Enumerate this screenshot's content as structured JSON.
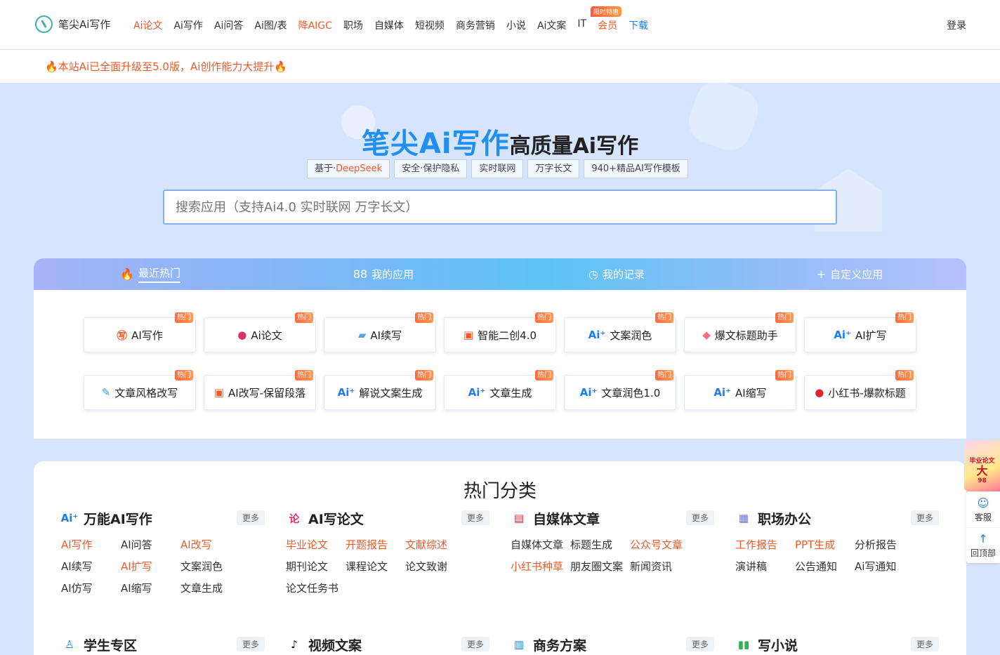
{
  "header": {
    "logo": "笔尖Ai写作",
    "nav": [
      {
        "label": "Ai论文",
        "style": "red"
      },
      {
        "label": "Ai写作",
        "style": ""
      },
      {
        "label": "Ai问答",
        "style": ""
      },
      {
        "label": "Ai图/表",
        "style": ""
      },
      {
        "label": "降AIGC",
        "style": "red"
      },
      {
        "label": "职场",
        "style": ""
      },
      {
        "label": "自媒体",
        "style": ""
      },
      {
        "label": "短视频",
        "style": ""
      },
      {
        "label": "商务营销",
        "style": ""
      },
      {
        "label": "小说",
        "style": ""
      },
      {
        "label": "Ai文案",
        "style": ""
      },
      {
        "label": "IT",
        "style": ""
      },
      {
        "label": "会员",
        "style": "red"
      },
      {
        "label": "下载",
        "style": "blue"
      }
    ],
    "limited_badge": "限时特惠",
    "login": "登录"
  },
  "notice": "🔥本站Ai已全面升级至5.0版，Ai创作能力大提升🔥",
  "hero": {
    "brand": "笔尖Ai写作",
    "tagline": "高质量Ai写作",
    "tag_prefix": "基于·",
    "tag_highlight": "DeepSeek",
    "tags": [
      "安全·保护隐私",
      "实时联网",
      "万字长文",
      "940+精品AI写作模板"
    ],
    "search_placeholder": "搜索应用（支持Ai4.0 实时联网 万字长文）"
  },
  "tabs": [
    {
      "icon": "🔥",
      "icon_name": "flame-icon",
      "label": "最近热门",
      "active": true
    },
    {
      "icon": "88",
      "icon_name": "grid-icon",
      "label": "我的应用",
      "active": false
    },
    {
      "icon": "◷",
      "icon_name": "clock-icon",
      "label": "我的记录",
      "active": false
    },
    {
      "icon": "+",
      "icon_name": "plus-icon",
      "label": "自定义应用",
      "active": false
    }
  ],
  "hot_label": "热门",
  "apps": [
    {
      "label": "AI写作",
      "icon": "㊢",
      "color": "#f05a28"
    },
    {
      "label": "Ai论文",
      "icon": "●",
      "color": "#d6336c"
    },
    {
      "label": "AI续写",
      "icon": "▰",
      "color": "#5aa0e6"
    },
    {
      "label": "智能二创4.0",
      "icon": "▣",
      "color": "#f05a28"
    },
    {
      "label": "文案润色",
      "icon": "Ai⁺",
      "color": "#1a7df0"
    },
    {
      "label": "爆文标题助手",
      "icon": "◆",
      "color": "#ff6b7a"
    },
    {
      "label": "AI扩写",
      "icon": "Ai⁺",
      "color": "#1a7df0"
    },
    {
      "label": "文章风格改写",
      "icon": "✎",
      "color": "#3aa0e6"
    },
    {
      "label": "AI改写-保留段落",
      "icon": "▣",
      "color": "#f05a28"
    },
    {
      "label": "解说文案生成",
      "icon": "Ai⁺",
      "color": "#1a7df0"
    },
    {
      "label": "文章生成",
      "icon": "Ai⁺",
      "color": "#1a7df0"
    },
    {
      "label": "文章润色1.0",
      "icon": "Ai⁺",
      "color": "#1a7df0"
    },
    {
      "label": "AI缩写",
      "icon": "Ai⁺",
      "color": "#1a7df0"
    },
    {
      "label": "小红书-爆款标题",
      "icon": "●",
      "color": "#e0242e"
    }
  ],
  "categories_title": "热门分类",
  "more_label": "更多",
  "categories": [
    {
      "name": "万能AI写作",
      "icon": "Ai⁺",
      "icon_color": "#1a7df0",
      "items": [
        {
          "label": "AI写作",
          "hl": true
        },
        {
          "label": "AI问答",
          "hl": false
        },
        {
          "label": "AI改写",
          "hl": true
        },
        {
          "label": "AI续写",
          "hl": false
        },
        {
          "label": "AI扩写",
          "hl": true
        },
        {
          "label": "文案润色",
          "hl": false
        },
        {
          "label": "AI仿写",
          "hl": false
        },
        {
          "label": "AI缩写",
          "hl": false
        },
        {
          "label": "文章生成",
          "hl": false
        }
      ]
    },
    {
      "name": "AI写论文",
      "icon": "论",
      "icon_color": "#d6336c",
      "items": [
        {
          "label": "毕业论文",
          "hl": true
        },
        {
          "label": "开题报告",
          "hl": true
        },
        {
          "label": "文献综述",
          "hl": true
        },
        {
          "label": "期刊论文",
          "hl": false
        },
        {
          "label": "课程论文",
          "hl": false
        },
        {
          "label": "论文致谢",
          "hl": false
        },
        {
          "label": "论文任务书",
          "hl": false
        }
      ]
    },
    {
      "name": "自媒体文章",
      "icon": "▤",
      "icon_color": "#e0242e",
      "items": [
        {
          "label": "自媒体文章",
          "hl": false
        },
        {
          "label": "标题生成",
          "hl": false
        },
        {
          "label": "公众号文章",
          "hl": true
        },
        {
          "label": "小红书种草",
          "hl": true
        },
        {
          "label": "朋友圈文案",
          "hl": false
        },
        {
          "label": "新闻资讯",
          "hl": false
        }
      ]
    },
    {
      "name": "职场办公",
      "icon": "▦",
      "icon_color": "#6a6ee8",
      "items": [
        {
          "label": "工作报告",
          "hl": true
        },
        {
          "label": "PPT生成",
          "hl": true
        },
        {
          "label": "分析报告",
          "hl": false
        },
        {
          "label": "演讲稿",
          "hl": false
        },
        {
          "label": "公告通知",
          "hl": false
        },
        {
          "label": "Ai写通知",
          "hl": false
        }
      ]
    },
    {
      "name": "学生专区",
      "icon": "♙",
      "icon_color": "#1a7df0",
      "items": []
    },
    {
      "name": "视频文案",
      "icon": "♪",
      "icon_color": "#111111",
      "items": []
    },
    {
      "name": "商务方案",
      "icon": "▥",
      "icon_color": "#1a7df0",
      "items": []
    },
    {
      "name": "写小说",
      "icon": "▮▮",
      "icon_color": "#2fb352",
      "items": []
    }
  ],
  "float": {
    "promo_line1": "毕业论文",
    "promo_line2": "大",
    "promo_line3": "98",
    "service": "客服",
    "top": "回顶部"
  }
}
